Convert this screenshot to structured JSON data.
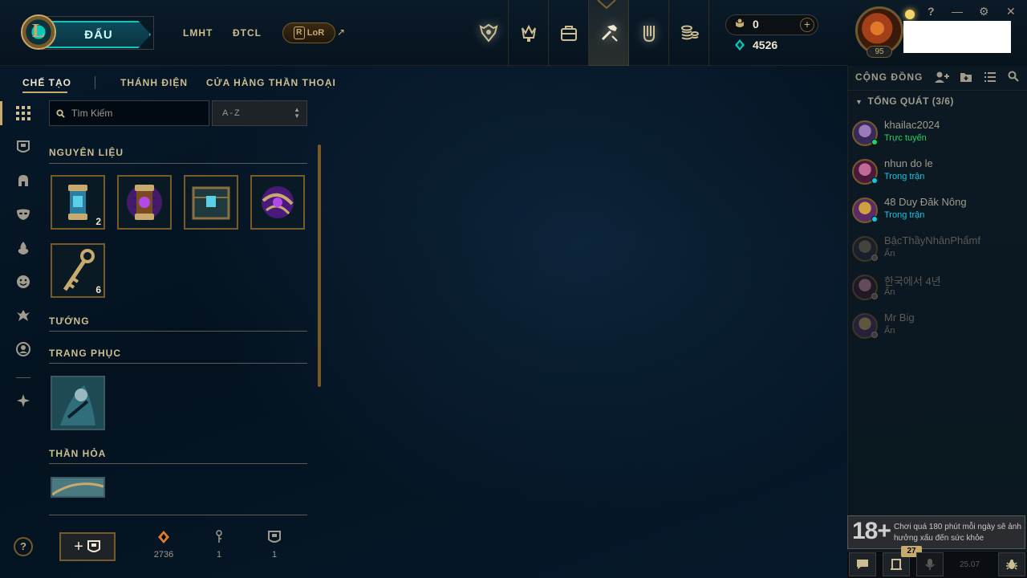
{
  "header": {
    "play_label": "ĐẤU",
    "nav_lmht": "LMHT",
    "nav_dtcl": "ĐTCL",
    "nav_lor": "LoR",
    "lor_badge": "R",
    "orange_essence": "0",
    "blue_essence": "4526",
    "level": "95",
    "window_controls": {
      "help": "?",
      "minimize": "—",
      "settings": "⚙",
      "close": "✕"
    }
  },
  "subnav": {
    "crafting": "CHẾ TẠO",
    "hall": "THÁNH ĐIỆN",
    "mythic_shop": "CỬA HÀNG THẦN THOẠI"
  },
  "filters": {
    "search_placeholder": "Tìm Kiếm",
    "sort_value": "A-Z"
  },
  "sections": {
    "materials": "NGUYÊN LIỆU",
    "champions": "TƯỚNG",
    "skins": "TRANG PHỤC",
    "ward_skins": "THẦN HỎA"
  },
  "materials": [
    {
      "name": "capsule",
      "count": "2"
    },
    {
      "name": "mythic-orb",
      "count": ""
    },
    {
      "name": "hextech-chest",
      "count": ""
    },
    {
      "name": "purple-orb",
      "count": ""
    },
    {
      "name": "hextech-key",
      "count": "6"
    }
  ],
  "resources": {
    "orange_essence": "2736",
    "key_fragments": "1",
    "tokens": "1"
  },
  "help_label": "?",
  "add_label": "+",
  "social": {
    "title": "CỘNG ĐỒNG",
    "group": "TỔNG QUÁT (3/6)",
    "friends": [
      {
        "name": "khailac2024",
        "status": "Trực tuyến",
        "state": "online"
      },
      {
        "name": "nhun do le",
        "status": "Trong trận",
        "state": "ingame"
      },
      {
        "name": "48 Duy Đăk Nông",
        "status": "Trong trận",
        "state": "ingame"
      },
      {
        "name": "BậcThầyNhânPhẩmf",
        "status": "Ẩn",
        "state": "offline"
      },
      {
        "name": "한국에서 4년",
        "status": "Ẩn",
        "state": "offline"
      },
      {
        "name": "Mr Big",
        "status": "Ẩn",
        "state": "offline"
      }
    ]
  },
  "age_warning": {
    "rating": "18+",
    "text": "Chơi quá 180 phút mỗi ngày sẽ ảnh hưởng xấu đến sức khỏe"
  },
  "footer": {
    "badge_count": "27",
    "version": "25.07"
  },
  "colors": {
    "gold": "#c8aa6e",
    "gold_dark": "#785a28",
    "teal": "#0ac8b9",
    "online_green": "#1ed760",
    "ingame_blue": "#0acbe6",
    "background": "#010a13"
  }
}
